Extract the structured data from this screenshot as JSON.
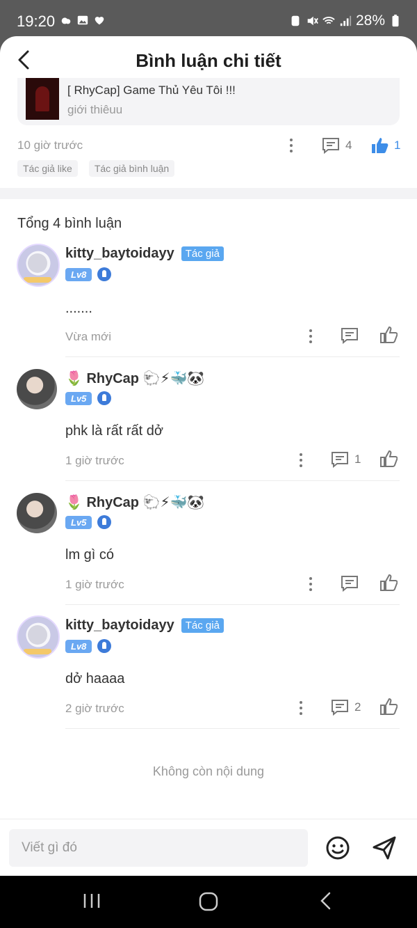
{
  "status_bar": {
    "time": "19:20",
    "battery": "28%"
  },
  "header": {
    "title": "Bình luận chi tiết"
  },
  "post": {
    "title": "[ RhyCap] Game Thủ Yêu Tôi !!!",
    "subtitle": "giới thiêuu",
    "time": "10 giờ trước",
    "comment_count": "4",
    "like_count": "1",
    "tags": [
      "Tác giả like",
      "Tác giả bình luận"
    ]
  },
  "comments_total": "Tổng 4 bình luận",
  "comments": [
    {
      "username": "kitty_baytoidayy",
      "badge": "Tác giả",
      "level": "Lv8",
      "text": ".......",
      "time": "Vừa mới",
      "reply_count": ""
    },
    {
      "username": "🌷 RhyCap 🐑⚡🐳🐼",
      "badge": "",
      "level": "Lv5",
      "text": "phk là rất rất dở",
      "time": "1 giờ trước",
      "reply_count": "1"
    },
    {
      "username": "🌷 RhyCap 🐑⚡🐳🐼",
      "badge": "",
      "level": "Lv5",
      "text": "lm gì có",
      "time": "1 giờ trước",
      "reply_count": ""
    },
    {
      "username": "kitty_baytoidayy",
      "badge": "Tác giả",
      "level": "Lv8",
      "text": "dở haaaa",
      "time": "2 giờ trước",
      "reply_count": "2"
    }
  ],
  "end_text": "Không còn nội dung",
  "input": {
    "placeholder": "Viết gì đó"
  },
  "icons": {
    "back": "back-arrow-icon",
    "comment": "comment-icon",
    "like": "thumbs-up-icon",
    "more": "more-vertical-icon",
    "emoji": "smiley-icon",
    "send": "send-icon"
  },
  "colors": {
    "accent": "#3d8de8",
    "author_badge": "#5aa7f0",
    "level_badge": "#6aa8f2"
  }
}
